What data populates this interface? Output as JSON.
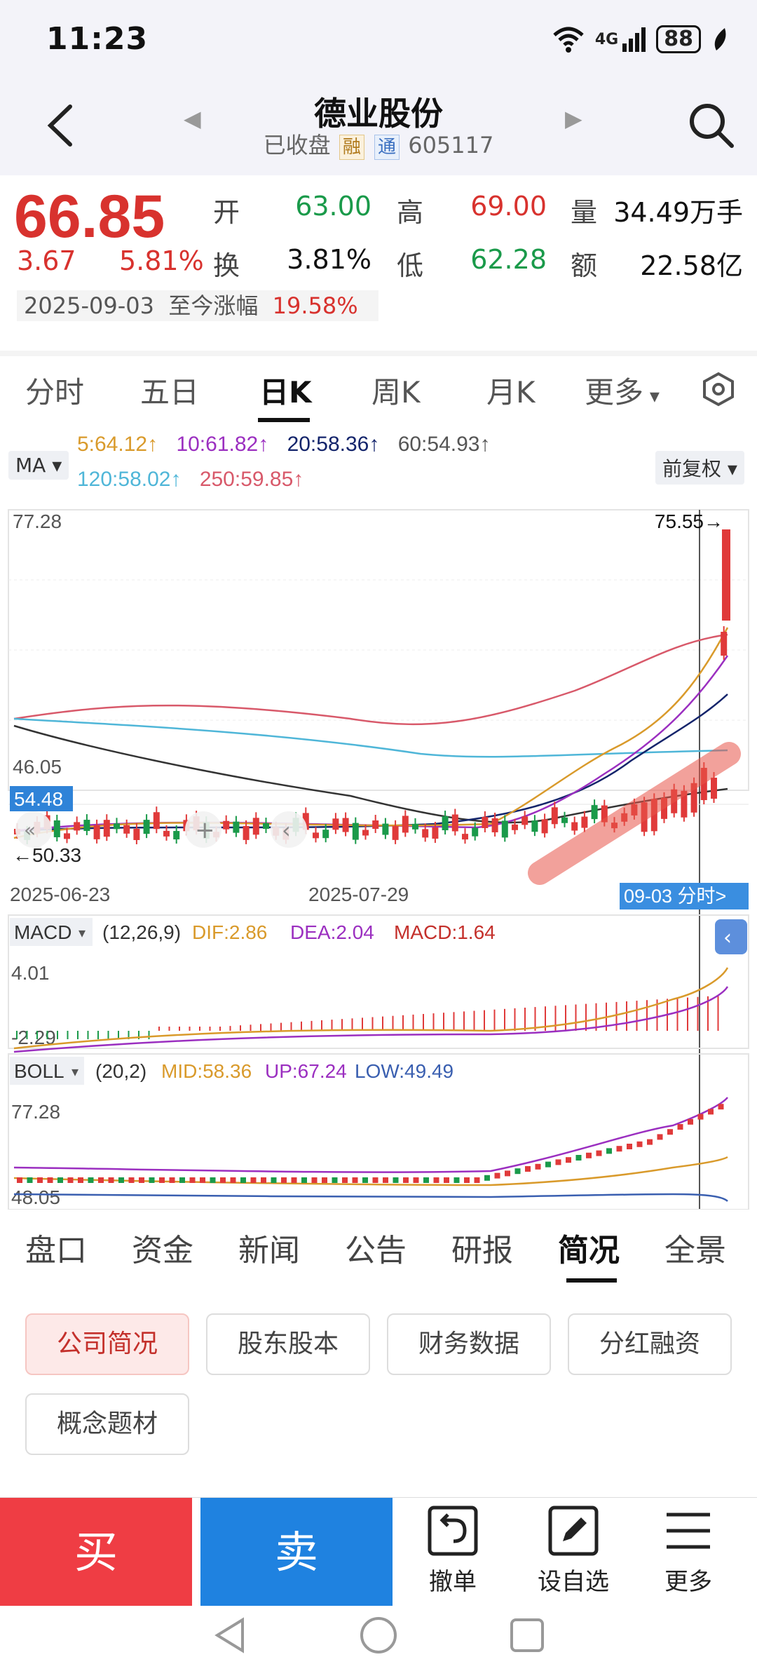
{
  "status_bar": {
    "time": "11:23",
    "network": "4G",
    "battery": "88"
  },
  "header": {
    "title": "德业股份",
    "status": "已收盘",
    "tag_rong": "融",
    "tag_tong": "通",
    "code": "605117"
  },
  "quote": {
    "price": "66.85",
    "change": "3.67",
    "change_pct": "5.81%",
    "date": "2025-09-03",
    "gain_label": "至今涨幅",
    "gain_pct": "19.58%",
    "open_label": "开",
    "open": "63.00",
    "high_label": "高",
    "high": "69.00",
    "vol_label": "量",
    "volume": "34.49万手",
    "turnover_label": "换",
    "turnover": "3.81%",
    "low_label": "低",
    "low": "62.28",
    "amount_label": "额",
    "amount": "22.58亿"
  },
  "chart_tabs": [
    "分时",
    "五日",
    "日K",
    "周K",
    "月K",
    "更多"
  ],
  "ma": {
    "selector": "MA",
    "values": [
      {
        "text": "5:64.12↑",
        "color": "#d99a2b"
      },
      {
        "text": "10:61.82↑",
        "color": "#9b2fc0"
      },
      {
        "text": "20:58.36↑",
        "color": "#13246b"
      },
      {
        "text": "60:54.93↑",
        "color": "#555555"
      },
      {
        "text": "120:58.02↑",
        "color": "#4fb6d8"
      },
      {
        "text": "250:59.85↑",
        "color": "#d8596a"
      }
    ],
    "adjust": "前复权"
  },
  "kline": {
    "y_max": "77.28",
    "y_min": "46.05",
    "marker_high": "75.55→",
    "marker_low": "←50.33",
    "price_tag": "54.48",
    "date_left": "2025-06-23",
    "date_mid": "2025-07-29",
    "date_right": "09-03 分时>"
  },
  "chart_data": {
    "type": "candlestick",
    "y_range": [
      46.05,
      77.28
    ],
    "x_ticks": [
      "2025-06-23",
      "2025-07-29"
    ],
    "last_candle": {
      "open": 63.0,
      "high": 69.0,
      "low": 62.28,
      "close": 66.85
    },
    "ma": {
      "MA5": 64.12,
      "MA10": 61.82,
      "MA20": 58.36,
      "MA60": 54.93,
      "MA120": 58.02,
      "MA250": 59.85
    },
    "macd": {
      "params": "(12,26,9)",
      "DIF": 2.86,
      "DEA": 2.04,
      "MACD": 1.64,
      "y_max": 4.01,
      "y_min": -2.29
    },
    "boll": {
      "params": "(20,2)",
      "MID": 58.36,
      "UP": 67.24,
      "LOW": 49.49,
      "y_max": 77.28,
      "y_min": 48.05
    }
  },
  "macd": {
    "selector": "MACD",
    "params": "(12,26,9)",
    "dif": "DIF:2.86",
    "dea": "DEA:2.04",
    "macd": "MACD:1.64",
    "y_max": "4.01",
    "y_min": "-2.29"
  },
  "boll": {
    "selector": "BOLL",
    "params": "(20,2)",
    "mid": "MID:58.36",
    "up": "UP:67.24",
    "low": "LOW:49.49",
    "y_max": "77.28",
    "y_min": "48.05"
  },
  "bottom_tabs": [
    "盘口",
    "资金",
    "新闻",
    "公告",
    "研报",
    "简况",
    "全景"
  ],
  "sub_buttons": [
    "公司简况",
    "股东股本",
    "财务数据",
    "分红融资",
    "概念题材"
  ],
  "actions": {
    "buy": "买",
    "sell": "卖",
    "cancel": "撤单",
    "watchlist": "设自选",
    "more": "更多"
  }
}
